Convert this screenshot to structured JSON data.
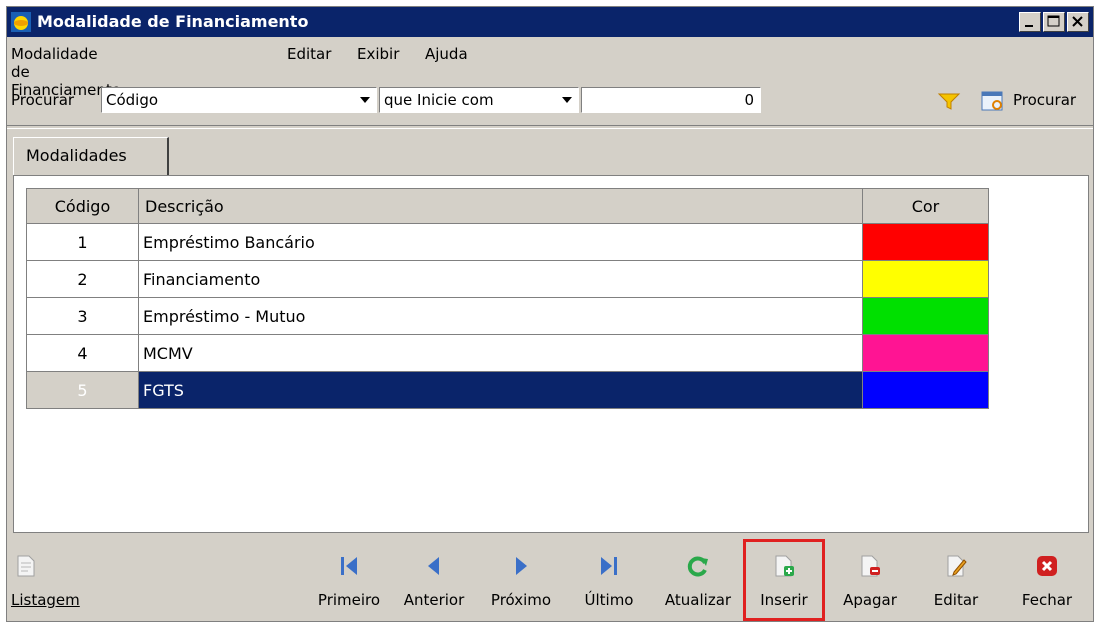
{
  "window": {
    "title": "Modalidade de Financiamento"
  },
  "menu": [
    "Modalidade de Financiamento",
    "Editar",
    "Exibir",
    "Ajuda"
  ],
  "search": {
    "label": "Procurar",
    "field": "Código",
    "condition": "que Inicie com",
    "value": "0",
    "button": "Procurar"
  },
  "tabs": [
    "Modalidades"
  ],
  "grid": {
    "headers": [
      "Código",
      "Descrição",
      "Cor"
    ],
    "rows": [
      {
        "code": "1",
        "desc": "Empréstimo Bancário",
        "color": "#ff0000"
      },
      {
        "code": "2",
        "desc": "Financiamento",
        "color": "#ffff00"
      },
      {
        "code": "3",
        "desc": "Empréstimo - Mutuo",
        "color": "#00e000"
      },
      {
        "code": "4",
        "desc": "MCMV",
        "color": "#ff1493"
      },
      {
        "code": "5",
        "desc": "FGTS",
        "color": "#0000ff"
      }
    ],
    "selected_row": 5
  },
  "toolbar": {
    "listagem": {
      "label": "Listagem",
      "icon": "document-icon"
    },
    "primeiro": {
      "label": "Primeiro",
      "icon": "first-icon"
    },
    "anterior": {
      "label": "Anterior",
      "icon": "previous-icon"
    },
    "proximo": {
      "label": "Próximo",
      "icon": "next-icon"
    },
    "ultimo": {
      "label": "Último",
      "icon": "last-icon"
    },
    "atualizar": {
      "label": "Atualizar",
      "icon": "refresh-icon"
    },
    "inserir": {
      "label": "Inserir",
      "icon": "insert-icon"
    },
    "apagar": {
      "label": "Apagar",
      "icon": "delete-icon"
    },
    "editar": {
      "label": "Editar",
      "icon": "edit-icon"
    },
    "fechar": {
      "label": "Fechar",
      "icon": "close-icon"
    }
  },
  "colors": {
    "titlebar": "#0a246a",
    "highlight": "#e02020",
    "window_bg": "#d4d0c8"
  }
}
